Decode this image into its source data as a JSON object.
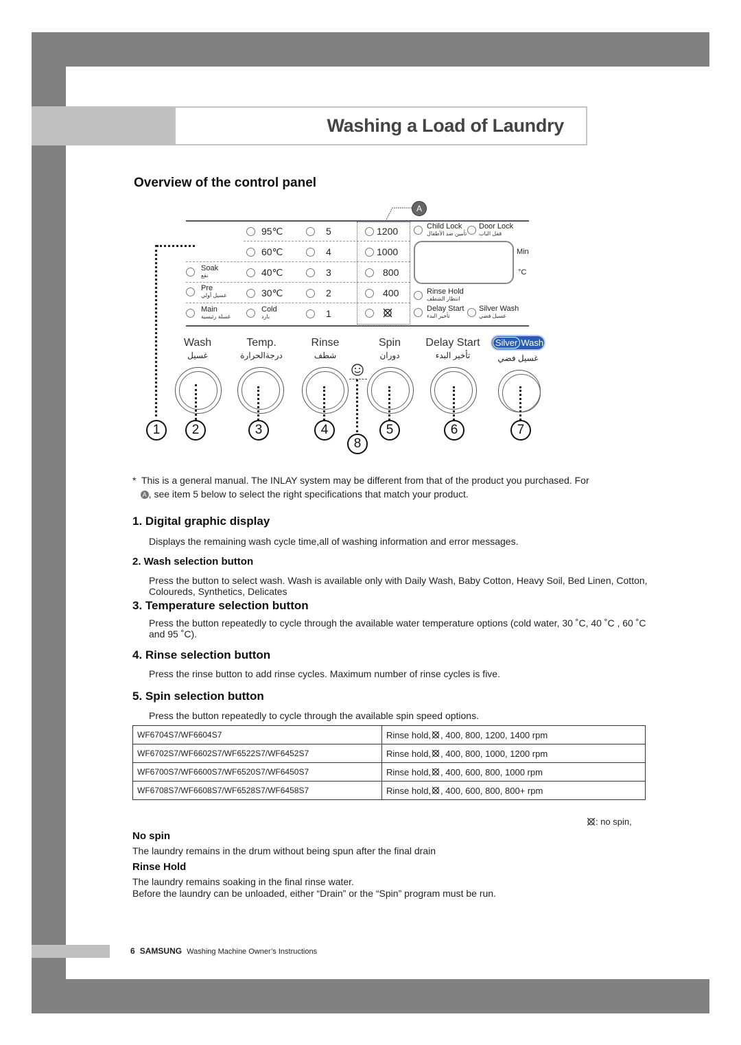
{
  "page": {
    "title": "Washing a Load of Laundry",
    "section_title": "Overview of the control panel",
    "footer": {
      "page_number": "6",
      "brand": "SAMSUNG",
      "doc_title": "Washing Machine Owner’s Instructions"
    }
  },
  "control_panel": {
    "badge_a": "A",
    "wash_options": [
      {
        "label": "Soak",
        "arabic": "نقع"
      },
      {
        "label": "Pre",
        "arabic": "غسيل أولي"
      },
      {
        "label": "Main",
        "arabic": "غسلة رئيسية"
      }
    ],
    "temp_options": [
      "95℃",
      "60℃",
      "40℃",
      "30℃",
      {
        "label": "Cold",
        "arabic": "بارد"
      }
    ],
    "temp_cold": {
      "label": "Cold",
      "arabic": "بارد"
    },
    "temp_values": [
      "95℃",
      "60℃",
      "40℃",
      "30℃"
    ],
    "rinse_options": [
      "5",
      "4",
      "3",
      "2",
      "1"
    ],
    "spin_options": [
      "1200",
      "1000",
      "800",
      "400"
    ],
    "spin_nospin_icon": "no-spin-icon",
    "indicators": {
      "child_lock": {
        "label": "Child Lock",
        "arabic": "تأمين ضد الأطفال"
      },
      "door_lock": {
        "label": "Door Lock",
        "arabic": "قفل الباب"
      },
      "rinse_hold": {
        "label": "Rinse Hold",
        "arabic": "انتظار الشطف"
      },
      "delay_start": {
        "label": "Delay Start",
        "arabic": "تأخير البدء"
      },
      "silver_wash": {
        "label": "Silver Wash",
        "arabic": "غسيل فضي"
      }
    },
    "display_units": {
      "min": "Min",
      "celsius": "°C"
    },
    "buttons": [
      {
        "label": "Wash",
        "arabic": "غسيل",
        "number": "2"
      },
      {
        "label": "Temp.",
        "arabic": "درجةالحرارة",
        "number": "3"
      },
      {
        "label": "Rinse",
        "arabic": "شطف",
        "number": "4"
      },
      {
        "label": "Spin",
        "arabic": "دوران",
        "number": "5"
      },
      {
        "label": "Delay Start",
        "arabic": "تأخير البدء",
        "number": "6"
      },
      {
        "label": "SilverWash",
        "badge_left": "Silver",
        "badge_right": "Wash",
        "arabic": "غسيل فضي",
        "number": "7"
      }
    ],
    "callout_display_number": "1",
    "callout_childlock_number": "8",
    "childlock_icon": "baby-face-icon"
  },
  "note": {
    "asterisk": "*",
    "line1": "This is a general manual. The INLAY system may be different from that of the product you purchased. For",
    "badge": "A",
    "line2": ", see item 5 below to select the right specifications that match your product."
  },
  "sections": [
    {
      "heading": "1. Digital graphic display",
      "body": "Displays the remaining wash cycle time,all of washing information and error messages."
    },
    {
      "heading": "2. Wash selection button",
      "body": "Press the button to select wash. Wash is available only with Daily Wash, Baby Cotton, Heavy Soil, Bed Linen, Cotton, Coloureds, Synthetics, Delicates"
    },
    {
      "heading": "3. Temperature selection button",
      "body": "Press the button  repeatedly to cycle through the available water temperature options  (cold water, 30 ˚C, 40 ˚C , 60 ˚C and 95 ˚C)."
    },
    {
      "heading": "4. Rinse selection button",
      "body": "Press the rinse button to add rinse cycles. Maximum number of rinse cycles is five."
    },
    {
      "heading": "5. Spin selection button",
      "body": "Press the button repeatedly to cycle through the available spin speed options."
    }
  ],
  "spin_table": {
    "rows": [
      {
        "models": "WF6704S7/WF6604S7",
        "prefix": "Rinse hold,",
        "speeds": ", 400,  800,  1200,  1400 rpm"
      },
      {
        "models": "WF6702S7/WF6602S7/WF6522S7/WF6452S7",
        "prefix": "Rinse hold,",
        "speeds": ", 400,  800,  1000,  1200 rpm"
      },
      {
        "models": "WF6700S7/WF6600S7/WF6520S7/WF6450S7",
        "prefix": "Rinse hold,",
        "speeds": ", 400,  600,  800,  1000 rpm"
      },
      {
        "models": "WF6708S7/WF6608S7/WF6528S7/WF6458S7",
        "prefix": "Rinse hold,",
        "speeds": ", 400,  600,  800,  800+ rpm"
      }
    ],
    "legend": ": no spin,"
  },
  "no_spin": {
    "heading": "No spin",
    "body": "The laundry remains in the drum without being spun after the final drain"
  },
  "rinse_hold": {
    "heading": "Rinse Hold",
    "body1": "The laundry remains soaking in the final rinse water.",
    "body2": "Before the laundry can be unloaded, either “Drain” or the “Spin” program must be run."
  }
}
